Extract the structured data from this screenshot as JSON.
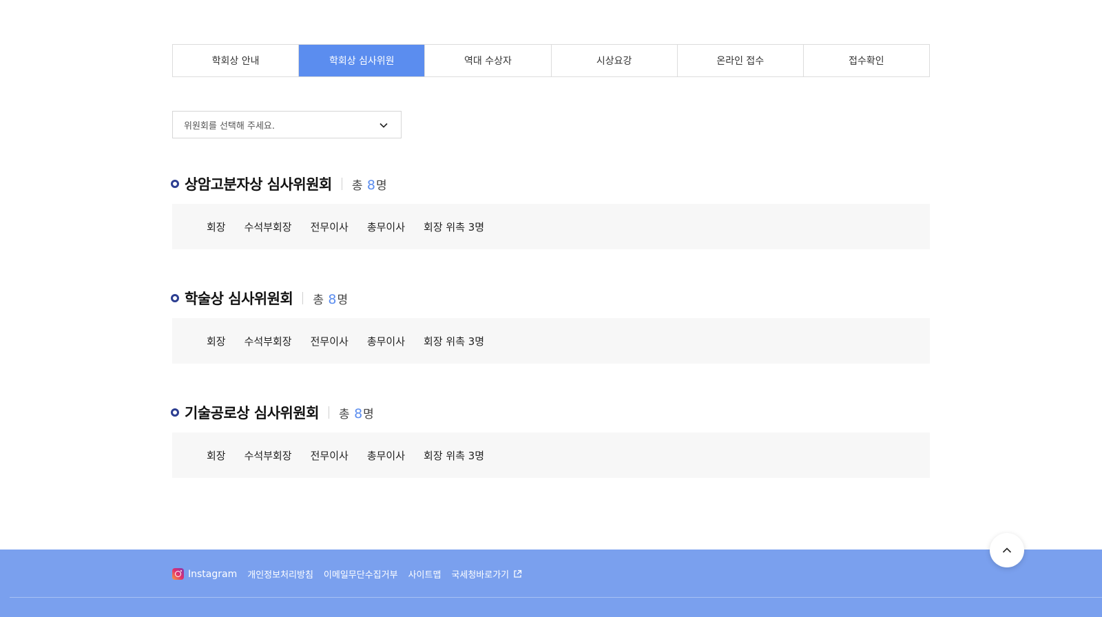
{
  "tabs": [
    {
      "label": "학회상 안내",
      "active": false
    },
    {
      "label": "학회상 심사위원",
      "active": true
    },
    {
      "label": "역대 수상자",
      "active": false
    },
    {
      "label": "시상요강",
      "active": false
    },
    {
      "label": "온라인 접수",
      "active": false
    },
    {
      "label": "접수확인",
      "active": false
    }
  ],
  "committee_select": {
    "placeholder": "위원회를 선택해 주세요."
  },
  "committees": [
    {
      "title": "상암고분자상 심사위원회",
      "total_prefix": "총",
      "count": "8",
      "total_suffix": "명",
      "roles": [
        "회장",
        "수석부회장",
        "전무이사",
        "총무이사",
        "회장 위촉 3명"
      ]
    },
    {
      "title": "학술상 심사위원회",
      "total_prefix": "총",
      "count": "8",
      "total_suffix": "명",
      "roles": [
        "회장",
        "수석부회장",
        "전무이사",
        "총무이사",
        "회장 위촉 3명"
      ]
    },
    {
      "title": "기술공로상 심사위원회",
      "total_prefix": "총",
      "count": "8",
      "total_suffix": "명",
      "roles": [
        "회장",
        "수석부회장",
        "전무이사",
        "총무이사",
        "회장 위촉 3명"
      ]
    }
  ],
  "footer": {
    "instagram": "Instagram",
    "links": [
      "개인정보처리방침",
      "이메일무단수집거부",
      "사이트맵"
    ],
    "external_link": "국세청바로가기"
  },
  "colors": {
    "accent": "#5b8def",
    "footer": "#7aa0ee",
    "dot": "#2c3e91"
  },
  "icons": {
    "select": "chevron-down-icon",
    "top": "chevron-up-icon",
    "external": "external-link-icon",
    "instagram": "instagram-icon"
  }
}
